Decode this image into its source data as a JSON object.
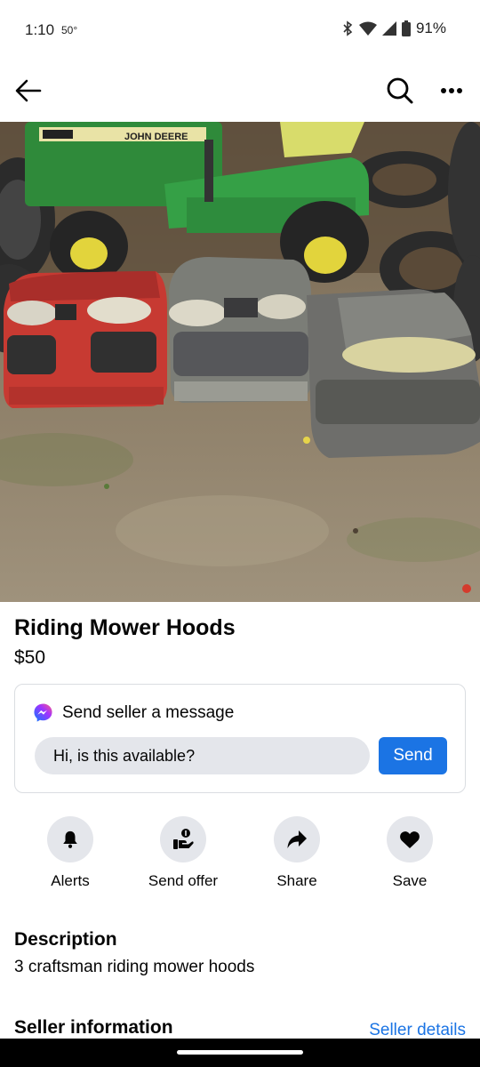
{
  "status_bar": {
    "time": "1:10",
    "temperature": "50°",
    "battery": "91%"
  },
  "app_bar": {
    "back_icon": "arrow-left-icon",
    "search_icon": "search-icon",
    "more_icon": "more-dots-icon"
  },
  "listing": {
    "photo_alt": "photo",
    "title": "Riding Mower Hoods",
    "price": "$50"
  },
  "message": {
    "title": "Send seller a message",
    "input_value": "Hi, is this available?",
    "send_label": "Send",
    "messenger_icon": "messenger-icon"
  },
  "actions": [
    {
      "label": "Alerts",
      "icon": "bell-icon"
    },
    {
      "label": "Send offer",
      "icon": "offer-hand-icon"
    },
    {
      "label": "Share",
      "icon": "share-arrow-icon"
    },
    {
      "label": "Save",
      "icon": "heart-icon"
    }
  ],
  "description": {
    "heading": "Description",
    "text": "3 craftsman riding mower hoods"
  },
  "seller": {
    "heading": "Seller information",
    "link": "Seller details"
  },
  "colors": {
    "accent": "#1b74e4",
    "chip_bg": "#e4e6eb"
  }
}
